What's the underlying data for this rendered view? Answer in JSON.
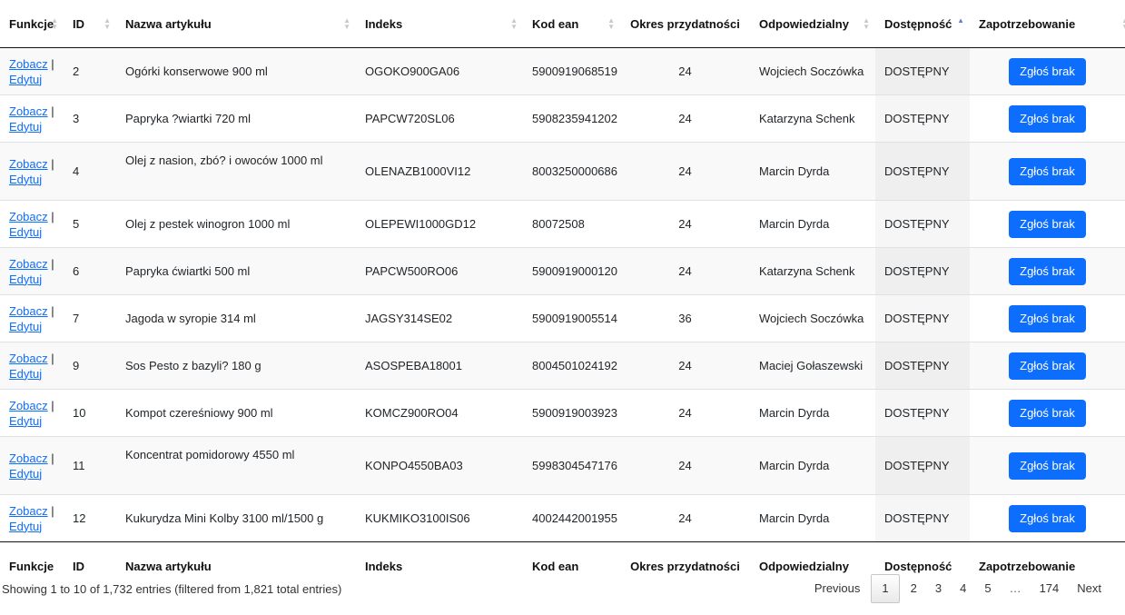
{
  "columns": [
    "Funkcje",
    "ID",
    "Nazwa artykułu",
    "Indeks",
    "Kod ean",
    "Okres przydatności",
    "Odpowiedzialny",
    "Dostępność",
    "Zapotrzebowanie"
  ],
  "row_links": {
    "view": "Zobacz",
    "separator": "|",
    "edit": "Edytuj"
  },
  "button_label": "Zgłoś brak",
  "rows": [
    {
      "id": "2",
      "name": "Ogórki konserwowe 900 ml",
      "index": "OGOKO900GA06",
      "ean": "5900919068519",
      "shelf": "24",
      "owner": "Wojciech Soczówka",
      "status": "DOSTĘPNY"
    },
    {
      "id": "3",
      "name": "Papryka ?wiartki 720 ml",
      "index": "PAPCW720SL06",
      "ean": "5908235941202",
      "shelf": "24",
      "owner": "Katarzyna Schenk",
      "status": "DOSTĘPNY"
    },
    {
      "id": "4",
      "name": "Olej z nasion, zbó? i owoców 1000 ml",
      "index": "OLENAZB1000VI12",
      "ean": "8003250000686",
      "shelf": "24",
      "owner": "Marcin Dyrda",
      "status": "DOSTĘPNY"
    },
    {
      "id": "5",
      "name": "Olej z pestek winogron 1000 ml",
      "index": "OLEPEWI1000GD12",
      "ean": "80072508",
      "shelf": "24",
      "owner": "Marcin Dyrda",
      "status": "DOSTĘPNY"
    },
    {
      "id": "6",
      "name": "Papryka ćwiartki 500 ml",
      "index": "PAPCW500RO06",
      "ean": "5900919000120",
      "shelf": "24",
      "owner": "Katarzyna Schenk",
      "status": "DOSTĘPNY"
    },
    {
      "id": "7",
      "name": "Jagoda w syropie 314 ml",
      "index": "JAGSY314SE02",
      "ean": "5900919005514",
      "shelf": "36",
      "owner": "Wojciech Soczówka",
      "status": "DOSTĘPNY"
    },
    {
      "id": "9",
      "name": "Sos Pesto z bazyli? 180 g",
      "index": "ASOSPEBA18001",
      "ean": "8004501024192",
      "shelf": "24",
      "owner": "Maciej Gołaszewski",
      "status": "DOSTĘPNY"
    },
    {
      "id": "10",
      "name": "Kompot czereśniowy 900 ml",
      "index": "KOMCZ900RO04",
      "ean": "5900919003923",
      "shelf": "24",
      "owner": "Marcin Dyrda",
      "status": "DOSTĘPNY"
    },
    {
      "id": "11",
      "name": "Koncentrat pomidorowy 4550 ml",
      "index": "KONPO4550BA03",
      "ean": "5998304547176",
      "shelf": "24",
      "owner": "Marcin Dyrda",
      "status": "DOSTĘPNY"
    },
    {
      "id": "12",
      "name": "Kukurydza Mini Kolby 3100 ml/1500 g",
      "index": "KUKMIKO3100IS06",
      "ean": "4002442001955",
      "shelf": "24",
      "owner": "Marcin Dyrda",
      "status": "DOSTĘPNY"
    }
  ],
  "info": "Showing 1 to 10 of 1,732 entries (filtered from 1,821 total entries)",
  "pagination": {
    "previous": "Previous",
    "pages": [
      "1",
      "2",
      "3",
      "4",
      "5",
      "…",
      "174"
    ],
    "current": "1",
    "next": "Next"
  },
  "colors": {
    "link": "#0d6efd",
    "button": "#0d6efd",
    "sort_active": "#6b7ccf"
  },
  "icons": {
    "sort": "sort-icon",
    "sort_asc": "sort-ascending-icon"
  }
}
